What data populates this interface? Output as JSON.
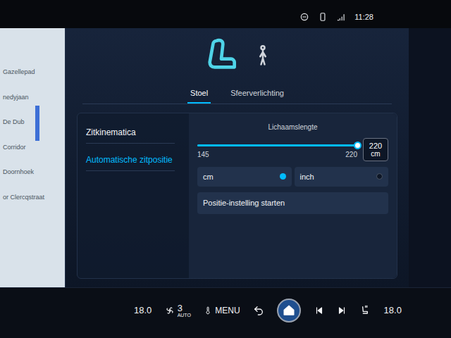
{
  "status_bar": {
    "time": "11:28"
  },
  "map": {
    "labels": [
      "Gazellepad",
      "nedyjaan",
      "De Dub",
      "Corridor",
      "Doornhoek",
      "or Clercqstraat"
    ]
  },
  "tabs": [
    {
      "label": "Stoel",
      "selected": true
    },
    {
      "label": "Sfeerverlichting",
      "selected": false
    }
  ],
  "menu": [
    {
      "label": "Zitkinematica",
      "selected": false
    },
    {
      "label": "Automatische zitpositie",
      "selected": true
    }
  ],
  "body_length": {
    "label": "Lichaamslengte",
    "min": "145",
    "value_below": "220",
    "value": "220",
    "unit": "cm",
    "level": 1.0
  },
  "units": [
    {
      "label": "cm",
      "selected": true
    },
    {
      "label": "inch",
      "selected": false
    }
  ],
  "start_button": "Positie-instelling starten",
  "bottom_bar": {
    "temp_left": "18.0",
    "fan": "3",
    "fan_mode": "AUTO",
    "menu": "MENU",
    "temp_right": "18.0"
  }
}
